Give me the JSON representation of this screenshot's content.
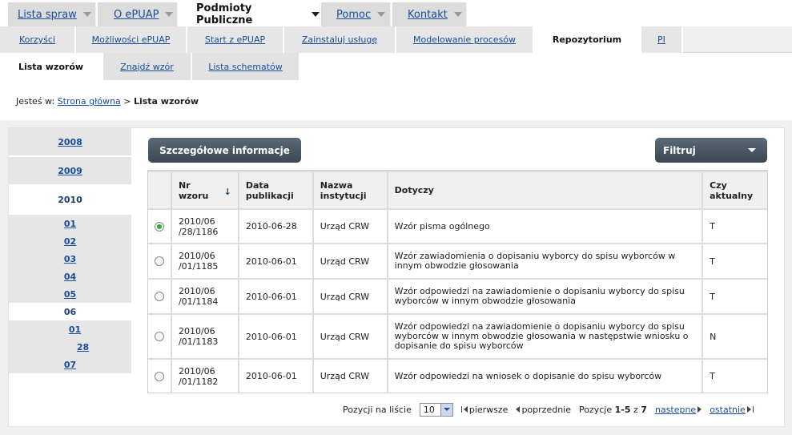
{
  "topnav": {
    "tabs": [
      {
        "label": "Lista spraw"
      },
      {
        "label": "O ePUAP"
      },
      {
        "label": "Podmioty Publiczne"
      },
      {
        "label": "Pomoc"
      },
      {
        "label": "Kontakt"
      }
    ]
  },
  "subnav": {
    "tabs": [
      {
        "label": "Korzyści"
      },
      {
        "label": "Możliwości ePUAP"
      },
      {
        "label": "Start z ePUAP"
      },
      {
        "label": "Zainstaluj usługę"
      },
      {
        "label": "Modelowanie procesów"
      },
      {
        "label": "Repozytorium"
      },
      {
        "label": "PI"
      }
    ]
  },
  "thirdnav": {
    "tabs": [
      {
        "label": "Lista wzorów"
      },
      {
        "label": "Znajdź wzór"
      },
      {
        "label": "Lista schematów"
      }
    ]
  },
  "breadcrumb": {
    "prefix": "Jesteś w:",
    "home": "Strona główna",
    "separator": ">",
    "current": "Lista wzorów"
  },
  "yearmenu": {
    "years": [
      "2008",
      "2009",
      "2010"
    ],
    "months": [
      "01",
      "02",
      "03",
      "04",
      "05",
      "06",
      "07"
    ],
    "days": [
      "01",
      "28"
    ]
  },
  "buttons": {
    "details": "Szczegółowe informacje",
    "filter": "Filtruj"
  },
  "table": {
    "headers": {
      "nr": "Nr wzoru",
      "date": "Data publikacji",
      "inst": "Nazwa instytucji",
      "subject": "Dotyczy",
      "current": "Czy aktualny"
    },
    "sort_indicator": "↓",
    "rows": [
      {
        "nr": "2010/06 /28/1186",
        "date": "2010-06-28",
        "inst": "Urząd CRW",
        "subject": "Wzór pisma ogólnego",
        "current": "T",
        "selected": true
      },
      {
        "nr": "2010/06 /01/1185",
        "date": "2010-06-01",
        "inst": "Urząd CRW",
        "subject": "Wzór zawiadomienia o dopisaniu wyborcy do spisu wyborców w innym obwodzie głosowania",
        "current": "T",
        "selected": false
      },
      {
        "nr": "2010/06 /01/1184",
        "date": "2010-06-01",
        "inst": "Urząd CRW",
        "subject": "Wzór odpowiedzi na zawiadomienie o dopisaniu wyborcy do spisu wyborców w innym obwodzie głosowania",
        "current": "T",
        "selected": false
      },
      {
        "nr": "2010/06 /01/1183",
        "date": "2010-06-01",
        "inst": "Urząd CRW",
        "subject": "Wzór odpowiedzi na zawiadomienie o dopisaniu wyborcy do spisu wyborców w innym obwodzie głosowania w następstwie wniosku o dopisanie do spisu wyborców",
        "current": "N",
        "selected": false
      },
      {
        "nr": "2010/06 /01/1182",
        "date": "2010-06-01",
        "inst": "Urząd CRW",
        "subject": "Wzór odpowiedzi na wniosek o dopisanie do spisu wyborców",
        "current": "T",
        "selected": false
      }
    ]
  },
  "pager": {
    "per_page_label": "Pozycji na liście",
    "per_page_value": "10",
    "first": "pierwsze",
    "prev": "poprzednie",
    "range_prefix": "Pozycje",
    "range": "1-5",
    "of": "z",
    "total": "7",
    "next": "nastepne",
    "last": "ostatnie"
  },
  "colors": {
    "link": "#1a4d9e",
    "button_dark": "#3b4651",
    "radio_selected": "#36a836"
  }
}
